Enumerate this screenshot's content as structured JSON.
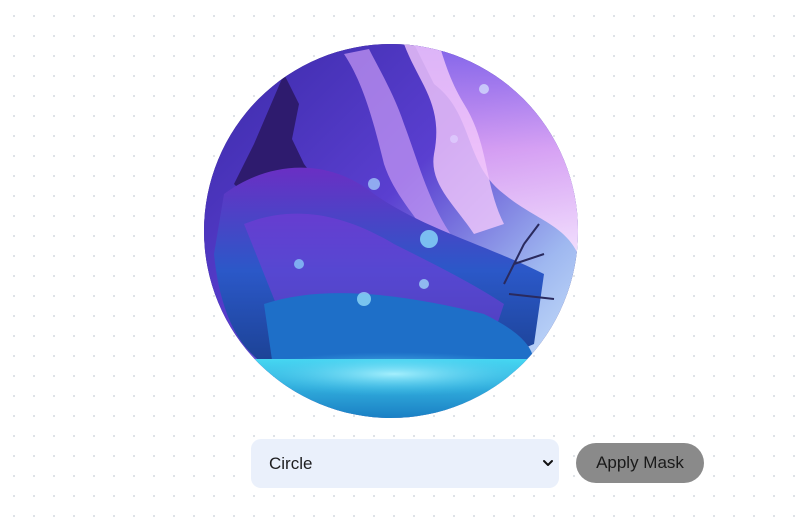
{
  "mask_controls": {
    "shape_select": {
      "selected": "Circle",
      "options": [
        "Circle"
      ]
    },
    "apply_button_label": "Apply Mask"
  },
  "image": {
    "mask_shape": "circle",
    "subject": "fantasy floating coral island with purple and blue flames and bubbles"
  },
  "colors": {
    "select_background": "#eaf0fb",
    "button_background": "#8a8a8a",
    "page_background": "#ffffff"
  }
}
